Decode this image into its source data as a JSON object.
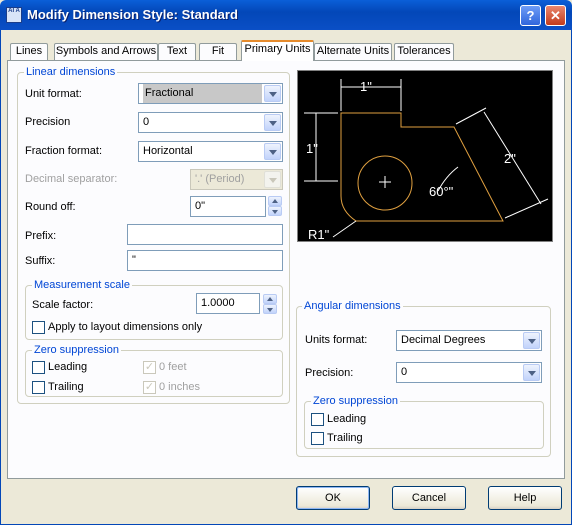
{
  "window": {
    "title": "Modify Dimension Style: Standard",
    "icon_text": "AI A",
    "help_glyph": "?",
    "close_glyph": "✕"
  },
  "tabs": [
    {
      "label": "Lines"
    },
    {
      "label": "Symbols and Arrows"
    },
    {
      "label": "Text"
    },
    {
      "label": "Fit"
    },
    {
      "label": "Primary Units",
      "active": true
    },
    {
      "label": "Alternate Units"
    },
    {
      "label": "Tolerances"
    }
  ],
  "linear": {
    "group_title": "Linear dimensions",
    "unit_format_label": "Unit format:",
    "unit_format_value": "Fractional",
    "precision_label": "Precision",
    "precision_value": "0",
    "fraction_format_label": "Fraction format:",
    "fraction_format_value": "Horizontal",
    "decimal_separator_label": "Decimal separator:",
    "decimal_separator_value": "'.' (Period)",
    "round_off_label": "Round off:",
    "round_off_value": "0\"",
    "prefix_label": "Prefix:",
    "prefix_value": "",
    "suffix_label": "Suffix:",
    "suffix_value": "\""
  },
  "measurement": {
    "group_title": "Measurement scale",
    "scale_factor_label": "Scale factor:",
    "scale_factor_value": "1.0000",
    "apply_layout_label": "Apply to layout dimensions only",
    "apply_layout_checked": false
  },
  "zero_linear": {
    "group_title": "Zero suppression",
    "leading_label": "Leading",
    "trailing_label": "Trailing",
    "feet_label": "0 feet",
    "inches_label": "0 inches",
    "check_glyph": "✓"
  },
  "angular": {
    "group_title": "Angular dimensions",
    "units_format_label": "Units format:",
    "units_format_value": "Decimal Degrees",
    "precision_label": "Precision:",
    "precision_value": "0",
    "zero_title": "Zero suppression",
    "leading_label": "Leading",
    "trailing_label": "Trailing"
  },
  "preview": {
    "dim_top": "1\"",
    "dim_left": "1\"",
    "dim_right": "2\"",
    "dim_angle": "60°\"",
    "dim_radius": "R1\"",
    "colors": {
      "geometry": "#e0a040",
      "dims": "#ffffff",
      "background": "#000000"
    }
  },
  "buttons": {
    "ok": "OK",
    "cancel": "Cancel",
    "help": "Help"
  }
}
